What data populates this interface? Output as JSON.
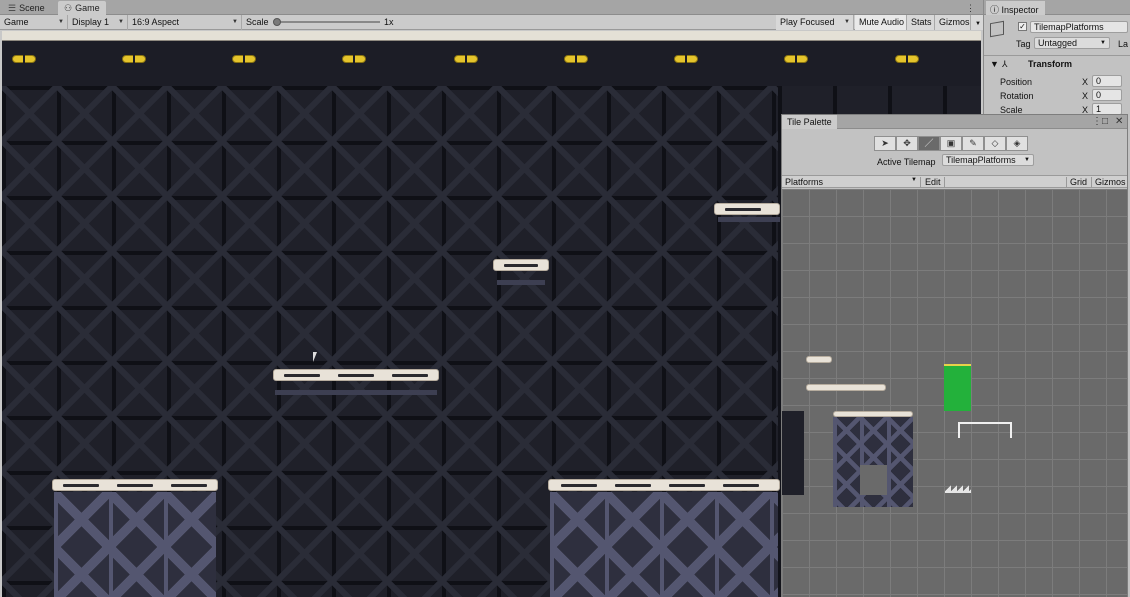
{
  "game_window": {
    "tabs": [
      {
        "label": "Scene",
        "icon": "scene-grid-icon"
      },
      {
        "label": "Game",
        "icon": "gamepad-icon"
      }
    ],
    "toolbar": {
      "display_mode": "Game",
      "display": "Display 1",
      "aspect": "16:9 Aspect",
      "scale_label": "Scale",
      "scale_value": "1x",
      "play_focused": "Play Focused",
      "mute_audio": "Mute Audio",
      "stats": "Stats",
      "gizmos": "Gizmos"
    }
  },
  "inspector": {
    "tab_label": "Inspector",
    "object_name": "TilemapPlatforms",
    "active": true,
    "tag_label": "Tag",
    "tag_value": "Untagged",
    "layer_label_partial": "La",
    "transform_header": "Transform",
    "rows": [
      {
        "label": "Position",
        "axis": "X",
        "value": "0"
      },
      {
        "label": "Rotation",
        "axis": "X",
        "value": "0"
      },
      {
        "label": "Scale",
        "axis": "X",
        "value": "1"
      }
    ]
  },
  "tile_palette": {
    "title": "Tile Palette",
    "tools": [
      {
        "name": "select-tool",
        "glyph": "➤"
      },
      {
        "name": "move-tool",
        "glyph": "✥"
      },
      {
        "name": "paintbrush-tool",
        "glyph": "／"
      },
      {
        "name": "box-fill-tool",
        "glyph": "▣"
      },
      {
        "name": "picker-tool",
        "glyph": "✎"
      },
      {
        "name": "eraser-tool",
        "glyph": "◇"
      },
      {
        "name": "fill-tool",
        "glyph": "◈"
      }
    ],
    "selected_tool_index": 2,
    "active_tilemap_label": "Active Tilemap",
    "active_tilemap_value": "TilemapPlatforms",
    "palette_name": "Platforms",
    "edit_label": "Edit",
    "grid_label": "Grid",
    "gizmos_label": "Gizmos"
  },
  "colors": {
    "platform": "#e8e2d8",
    "coin": "#e4c42c",
    "green_tile": "#23b13b",
    "background": "#1f2029"
  }
}
